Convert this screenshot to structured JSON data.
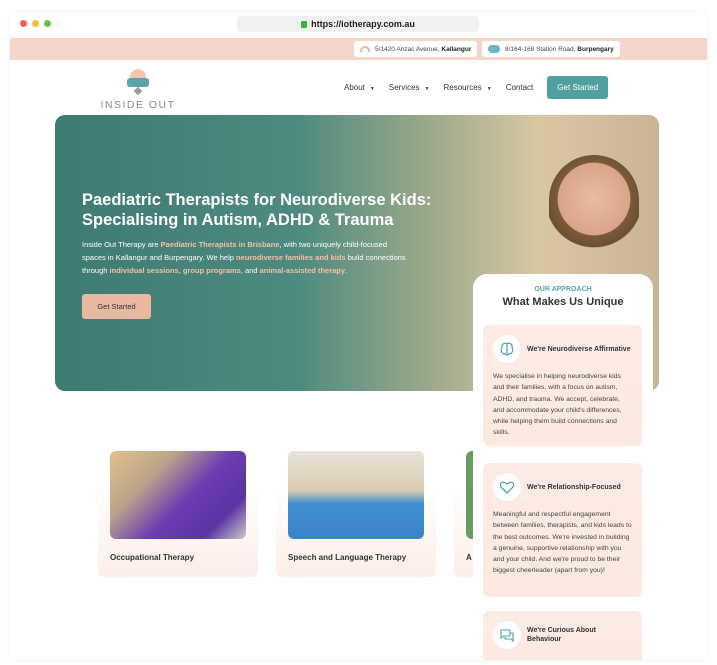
{
  "browser": {
    "url": "https://iotherapy.com.au",
    "dot_colors": [
      "#ee5f56",
      "#f4bd3f",
      "#5ec64a"
    ]
  },
  "topbar": {
    "locations": [
      {
        "street": "5/1420 Anzac Avenue,",
        "suburb": "Kallangur",
        "icon": "rainbow-icon"
      },
      {
        "street": "8/164-168 Station Road,",
        "suburb": "Burpengary",
        "icon": "brain-icon"
      }
    ]
  },
  "logo": {
    "text": "INSIDE OUT"
  },
  "nav": {
    "items": [
      {
        "label": "About",
        "dropdown": true
      },
      {
        "label": "Services",
        "dropdown": true
      },
      {
        "label": "Resources",
        "dropdown": true
      },
      {
        "label": "Contact",
        "dropdown": false
      }
    ],
    "cta": "Get Started"
  },
  "hero": {
    "title": "Paediatric Therapists for Neurodiverse Kids: Specialising in Autism, ADHD & Trauma",
    "p1": "Inside Out Therapy are ",
    "hl1": "Paediatric Therapists in Brisbane",
    "p2": ", with two uniquely child-focused spaces in Kallangur and Burpengary. We help ",
    "hl2": "neurodiverse families and kids",
    "p3": " build connections through ",
    "hl3": "individual sessions",
    "p4": ", ",
    "hl4": "group programs",
    "p5": ", and ",
    "hl5": "animal-assisted therapy",
    "p6": ".",
    "cta": "Get Started"
  },
  "services": [
    {
      "title": "Occupational Therapy"
    },
    {
      "title": "Speech and Language Therapy"
    },
    {
      "title": "A"
    }
  ],
  "approach": {
    "kicker": "OUR APPROACH",
    "heading": "What Makes Us Unique",
    "cards": [
      {
        "icon": "brain-icon",
        "title": "We're Neurodiverse Affirmative",
        "body": "We specialise in helping neurodiverse kids and their families, with a focus on autism, ADHD, and trauma. We accept, celebrate, and accommodate your child's differences, while helping them build connections and skills."
      },
      {
        "icon": "heart-icon",
        "title": "We're Relationship-Focused",
        "body": "Meaningful and respectful engagement between families, therapists, and kids leads to the best outcomes. We're invested in building a genuine, supportive relationship with you and your child. And we're proud to be their biggest cheerleader (apart from you)!"
      },
      {
        "icon": "chat-bubbles-icon",
        "title": "We're Curious About Behaviour",
        "body": ""
      }
    ]
  },
  "colors": {
    "teal": "#4fa09e",
    "peach": "#e9b8a0",
    "topbar": "#f4d6cb"
  }
}
